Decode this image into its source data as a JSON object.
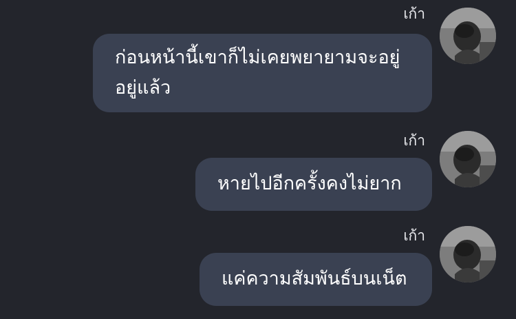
{
  "messages": [
    {
      "sender": "เก้า",
      "lines": [
        "ก่อนหน้านี้เขาก็ไม่เคยพยายามจะอยู่",
        "อยู่แล้ว"
      ]
    },
    {
      "sender": "เก้า",
      "lines": [
        "หายไปอีกครั้งคงไม่ยาก"
      ]
    },
    {
      "sender": "เก้า",
      "lines": [
        "แค่ความสัมพันธ์บนเน็ต"
      ]
    }
  ],
  "colors": {
    "background": "#23252c",
    "bubble": "#3a4152",
    "text": "#ffffff",
    "sender": "#e9eaee"
  },
  "icons": {
    "avatar": "avatar-photo-grayscale"
  }
}
